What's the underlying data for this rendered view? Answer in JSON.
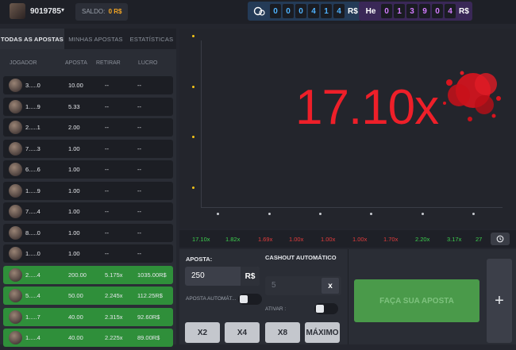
{
  "header": {
    "user_id": "9019785",
    "saldo_label": "SALDO:",
    "saldo_value": "0 R$",
    "counter1": {
      "icon": "coins-icon",
      "digits": [
        "0",
        "0",
        "0",
        "4",
        "1",
        "4"
      ],
      "currency": "R$"
    },
    "counter2": {
      "icon": "He",
      "digits": [
        "0",
        "1",
        "3",
        "9",
        "0",
        "4"
      ],
      "currency": "R$"
    }
  },
  "tabs": [
    "TODAS AS APOSTAS",
    "MINHAS APOSTAS",
    "ESTATÍSTICAS"
  ],
  "columns": [
    "JOGADOR",
    "APOSTA",
    "RETIRAR",
    "LUCRO"
  ],
  "rows": [
    {
      "player": "3.....0",
      "bet": "10.00",
      "cashout": "--",
      "profit": "--",
      "win": false
    },
    {
      "player": "1.....9",
      "bet": "5.33",
      "cashout": "--",
      "profit": "--",
      "win": false
    },
    {
      "player": "2.....1",
      "bet": "2.00",
      "cashout": "--",
      "profit": "--",
      "win": false
    },
    {
      "player": "7.....3",
      "bet": "1.00",
      "cashout": "--",
      "profit": "--",
      "win": false
    },
    {
      "player": "6.....6",
      "bet": "1.00",
      "cashout": "--",
      "profit": "--",
      "win": false
    },
    {
      "player": "1.....9",
      "bet": "1.00",
      "cashout": "--",
      "profit": "--",
      "win": false
    },
    {
      "player": "7.....4",
      "bet": "1.00",
      "cashout": "--",
      "profit": "--",
      "win": false
    },
    {
      "player": "8.....0",
      "bet": "1.00",
      "cashout": "--",
      "profit": "--",
      "win": false
    },
    {
      "player": "1.....0",
      "bet": "1.00",
      "cashout": "--",
      "profit": "--",
      "win": false
    },
    {
      "player": "2.....4",
      "bet": "200.00",
      "cashout": "5.175x",
      "profit": "1035.00R$",
      "win": true
    },
    {
      "player": "5.....4",
      "bet": "50.00",
      "cashout": "2.245x",
      "profit": "112.25R$",
      "win": true
    },
    {
      "player": "1.....7",
      "bet": "40.00",
      "cashout": "2.315x",
      "profit": "92.60R$",
      "win": true
    },
    {
      "player": "1.....4",
      "bet": "40.00",
      "cashout": "2.225x",
      "profit": "89.00R$",
      "win": true
    }
  ],
  "game": {
    "multiplier": "17.10x"
  },
  "history": [
    {
      "value": "17.10x",
      "color": "#3ccf4e"
    },
    {
      "value": "1.82x",
      "color": "#3ccf4e"
    },
    {
      "value": "1.69x",
      "color": "#e23c3c"
    },
    {
      "value": "1.00x",
      "color": "#e23c3c"
    },
    {
      "value": "1.00x",
      "color": "#e23c3c"
    },
    {
      "value": "1.00x",
      "color": "#e23c3c"
    },
    {
      "value": "1.70x",
      "color": "#e23c3c"
    },
    {
      "value": "2.20x",
      "color": "#3ccf4e"
    },
    {
      "value": "3.17x",
      "color": "#3ccf4e"
    },
    {
      "value": "27",
      "color": "#3ccf4e"
    }
  ],
  "bet": {
    "aposta_label": "APOSTA:",
    "aposta_value": "250",
    "currency": "R$",
    "auto_label": "APOSTA AUTOMÁT...",
    "cashout_label": "CASHOUT AUTOMÁTICO",
    "cashout_placeholder": "5",
    "cashout_unit": "x",
    "ativar_label": "ATIVAR :",
    "quick": [
      "X2",
      "X4",
      "X8",
      "MÁXIMO"
    ],
    "place_label": "FAÇA SUA APOSTA",
    "plus_label": "+"
  }
}
